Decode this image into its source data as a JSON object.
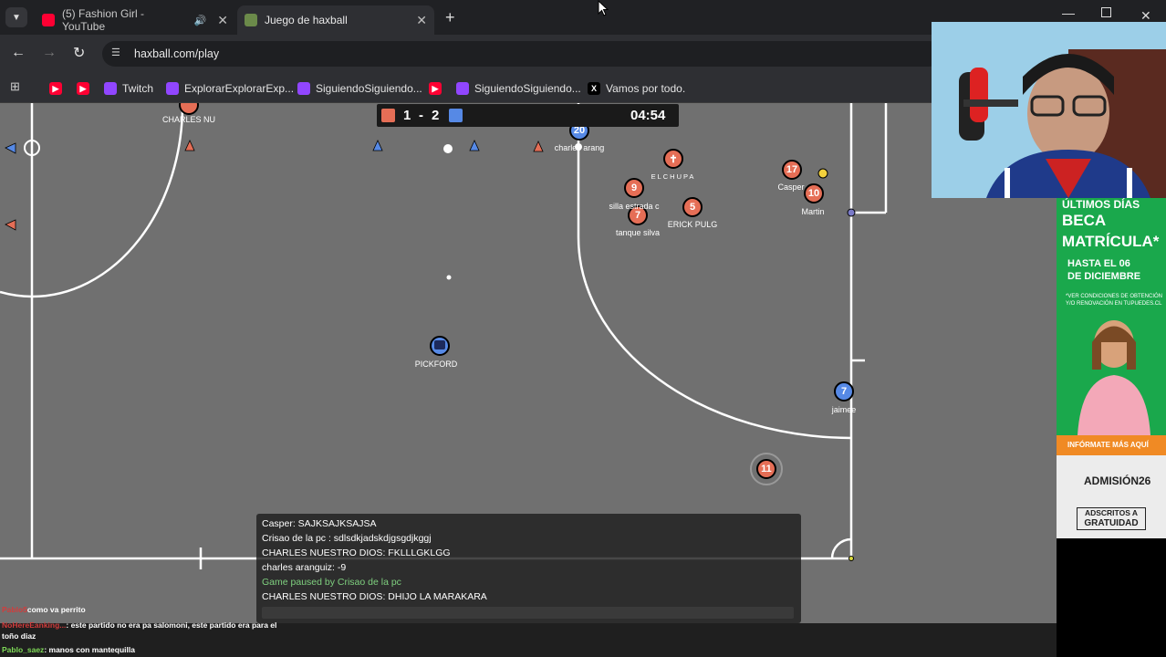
{
  "browser": {
    "tabs": [
      {
        "title": "(5) Fashion Girl - YouTube",
        "active": false
      },
      {
        "title": "Juego de haxball",
        "active": true
      }
    ],
    "url": "haxball.com/play",
    "bookmarks": [
      "Twitch",
      "ExplorarExplorarExp...",
      "SiguiendoSiguiendo...",
      "SiguiendoSiguiendo...",
      "Vamos por todo."
    ],
    "colors": {
      "tabbar": "#202124",
      "toolbar": "#2e2f33"
    }
  },
  "game": {
    "score": {
      "red": "1",
      "separator": "-",
      "blue": "2"
    },
    "timer": "04:54",
    "players": [
      {
        "name": "CHARLES NU",
        "number": "",
        "team": "red"
      },
      {
        "name": "charles arang",
        "number": "20",
        "team": "blue"
      },
      {
        "name": "ELCHUPA",
        "number": "✝",
        "team": "red"
      },
      {
        "name": "silla estrada c",
        "number": "9",
        "team": "red"
      },
      {
        "name": "tanque silva",
        "number": "7",
        "team": "red"
      },
      {
        "name": "ERICK PULG",
        "number": "5",
        "team": "red"
      },
      {
        "name": "Casper",
        "number": "17",
        "team": "red"
      },
      {
        "name": "Martin",
        "number": "10",
        "team": "red"
      },
      {
        "name": "PICKFORD",
        "number": "",
        "team": "blue"
      },
      {
        "name": "jaimee",
        "number": "7",
        "team": "blue"
      },
      {
        "name": "",
        "number": "11",
        "team": "red"
      }
    ],
    "colors": {
      "red": "#e56e56",
      "blue": "#5689e5",
      "field": "#707070"
    }
  },
  "chat": {
    "lines": [
      {
        "text": "Casper: SAJKSAJKSAJSA",
        "kind": "msg"
      },
      {
        "text": "Crisao de la pc : sdlsdkjadskdjgsgdjkggj",
        "kind": "msg"
      },
      {
        "text": "CHARLES NUESTRO DIOS: FKLLLGKLGG",
        "kind": "msg"
      },
      {
        "text": "charles aranguiz: -9",
        "kind": "msg"
      },
      {
        "text": "Game paused by Crisao de la pc",
        "kind": "notice"
      },
      {
        "text": "CHARLES NUESTRO DIOS: DHIJO LA MARAKARA",
        "kind": "msg"
      }
    ]
  },
  "stream_chat": [
    {
      "user": "Pablo5",
      "text": "como va perrito"
    },
    {
      "user": "NoHereEanking...",
      "text": ": este partido no era pa salomoni, este partido era para el toño diaz"
    },
    {
      "user": "Pablo_saez",
      "text": ": manos con mantequilla"
    }
  ],
  "ad": {
    "line1": "ÚLTIMOS DÍAS",
    "line2": "BECA",
    "line3": "MATRÍCULA*",
    "line4": "HASTA EL 06",
    "line5": "DE DICIEMBRE",
    "fineprint": "*VER CONDICIONES DE OBTENCIÓN Y/O RENOVACIÓN EN TUPUEDES.CL",
    "cta": "INFÓRMATE MÁS AQUÍ",
    "admision": "ADMISIÓN26",
    "badge_line1": "ADSCRITOS A",
    "badge_line2": "GRATUIDAD"
  }
}
